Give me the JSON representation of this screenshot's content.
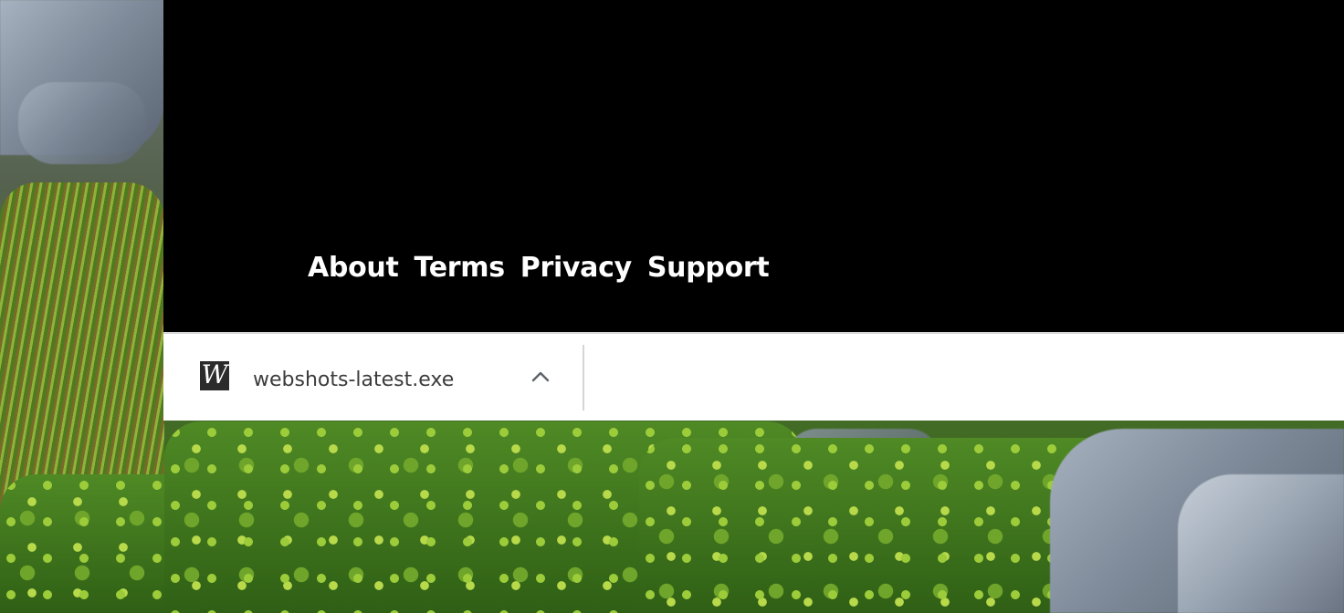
{
  "footer": {
    "links": [
      {
        "label": "About"
      },
      {
        "label": "Terms"
      },
      {
        "label": "Privacy"
      },
      {
        "label": "Support"
      }
    ]
  },
  "download_shelf": {
    "item": {
      "file_name": "webshots-latest.exe",
      "icon": "webshots-app-icon",
      "icon_glyph": "W",
      "expand_icon": "chevron-up-icon"
    }
  },
  "colors": {
    "page_background": "#000000",
    "footer_link": "#ffffff",
    "shelf_background": "#ffffff",
    "file_name_text": "#3c3c3c"
  }
}
